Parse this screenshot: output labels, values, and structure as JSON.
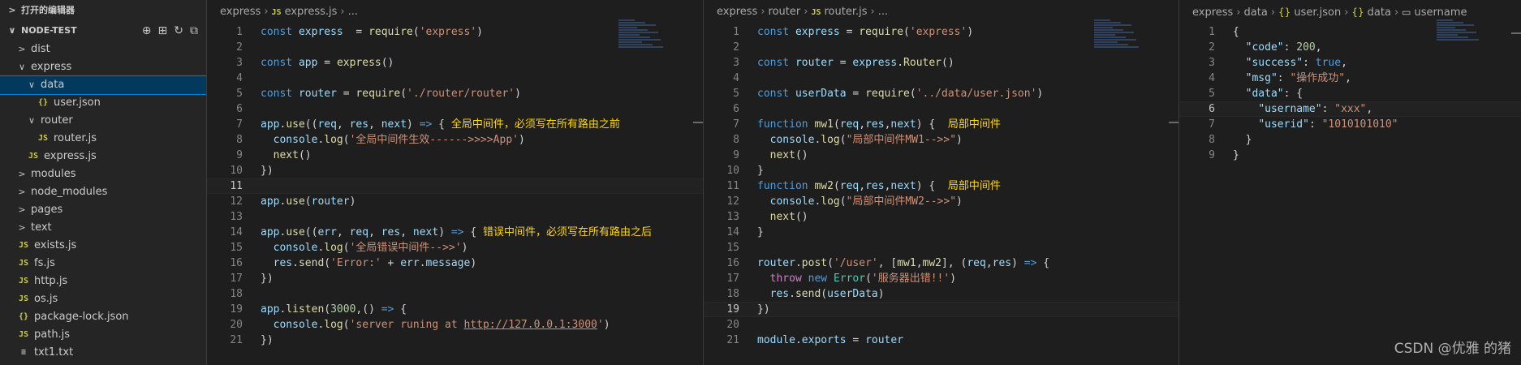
{
  "sidebar": {
    "header": "打开的编辑器",
    "project": "NODE-TEST",
    "tree": [
      {
        "label": "dist",
        "type": "folder",
        "open": false,
        "indent": 0
      },
      {
        "label": "express",
        "type": "folder",
        "open": true,
        "indent": 0
      },
      {
        "label": "data",
        "type": "folder",
        "open": true,
        "indent": 1,
        "selected": true
      },
      {
        "label": "user.json",
        "type": "json",
        "indent": 2
      },
      {
        "label": "router",
        "type": "folder",
        "open": true,
        "indent": 1
      },
      {
        "label": "router.js",
        "type": "js",
        "indent": 2
      },
      {
        "label": "express.js",
        "type": "js",
        "indent": 1
      },
      {
        "label": "modules",
        "type": "folder",
        "open": false,
        "indent": 0
      },
      {
        "label": "node_modules",
        "type": "folder",
        "open": false,
        "indent": 0
      },
      {
        "label": "pages",
        "type": "folder",
        "open": false,
        "indent": 0
      },
      {
        "label": "text",
        "type": "folder",
        "open": false,
        "indent": 0
      },
      {
        "label": "exists.js",
        "type": "js",
        "indent": 0
      },
      {
        "label": "fs.js",
        "type": "js",
        "indent": 0
      },
      {
        "label": "http.js",
        "type": "js",
        "indent": 0
      },
      {
        "label": "os.js",
        "type": "js",
        "indent": 0
      },
      {
        "label": "package-lock.json",
        "type": "json",
        "indent": 0
      },
      {
        "label": "path.js",
        "type": "js",
        "indent": 0
      },
      {
        "label": "txt1.txt",
        "type": "txt",
        "indent": 0
      }
    ]
  },
  "icons": {
    "js": "JS",
    "json": "{}",
    "txt": "≡",
    "folder_open": "∨",
    "folder_closed": ">"
  },
  "editors": [
    {
      "breadcrumb": [
        "express",
        "express.js",
        "..."
      ],
      "breadcrumb_types": [
        "plain",
        "js",
        "plain"
      ],
      "current_line": 11,
      "lines": [
        [
          [
            "kw",
            "const "
          ],
          [
            "var",
            "express"
          ],
          [
            "",
            "  = "
          ],
          [
            "fn",
            "require"
          ],
          [
            "",
            ""
          ],
          [
            "",
            "("
          ],
          [
            "str",
            "'express'"
          ],
          [
            "",
            ")"
          ]
        ],
        [],
        [
          [
            "kw",
            "const "
          ],
          [
            "var",
            "app"
          ],
          [
            "",
            " = "
          ],
          [
            "fn",
            "express"
          ],
          [
            "",
            "()"
          ]
        ],
        [],
        [
          [
            "kw",
            "const "
          ],
          [
            "var",
            "router"
          ],
          [
            "",
            " = "
          ],
          [
            "fn",
            "require"
          ],
          [
            "",
            "("
          ],
          [
            "str",
            "'./router/router'"
          ],
          [
            "",
            ")"
          ]
        ],
        [],
        [
          [
            "var",
            "app"
          ],
          [
            "",
            "."
          ],
          [
            "fn",
            "use"
          ],
          [
            "",
            "(("
          ],
          [
            "var",
            "req"
          ],
          [
            "",
            ", "
          ],
          [
            "var",
            "res"
          ],
          [
            "",
            ", "
          ],
          [
            "var",
            "next"
          ],
          [
            "",
            ") "
          ],
          [
            "kw",
            "=>"
          ],
          [
            "",
            " { "
          ],
          [
            "cmt",
            "全局中间件，必须写在所有路由之前"
          ]
        ],
        [
          [
            "",
            "  "
          ],
          [
            "var",
            "console"
          ],
          [
            "",
            "."
          ],
          [
            "fn",
            "log"
          ],
          [
            "",
            "("
          ],
          [
            "str",
            "'全局中间件生效------>>>>App'"
          ],
          [
            "",
            ")"
          ]
        ],
        [
          [
            "",
            "  "
          ],
          [
            "fn",
            "next"
          ],
          [
            "",
            "()"
          ]
        ],
        [
          [
            "",
            "})"
          ]
        ],
        [],
        [
          [
            "var",
            "app"
          ],
          [
            "",
            "."
          ],
          [
            "fn",
            "use"
          ],
          [
            "",
            "("
          ],
          [
            "var",
            "router"
          ],
          [
            "",
            ")"
          ]
        ],
        [],
        [
          [
            "var",
            "app"
          ],
          [
            "",
            "."
          ],
          [
            "fn",
            "use"
          ],
          [
            "",
            "(("
          ],
          [
            "var",
            "err"
          ],
          [
            "",
            ", "
          ],
          [
            "var",
            "req"
          ],
          [
            "",
            ", "
          ],
          [
            "var",
            "res"
          ],
          [
            "",
            ", "
          ],
          [
            "var",
            "next"
          ],
          [
            "",
            ") "
          ],
          [
            "kw",
            "=>"
          ],
          [
            "",
            " { "
          ],
          [
            "cmt",
            "错误中间件，必须写在所有路由之后"
          ]
        ],
        [
          [
            "",
            "  "
          ],
          [
            "var",
            "console"
          ],
          [
            "",
            "."
          ],
          [
            "fn",
            "log"
          ],
          [
            "",
            "("
          ],
          [
            "str",
            "'全局错误中间件-->>'"
          ],
          [
            "",
            ")"
          ]
        ],
        [
          [
            "",
            "  "
          ],
          [
            "var",
            "res"
          ],
          [
            "",
            "."
          ],
          [
            "fn",
            "send"
          ],
          [
            "",
            "("
          ],
          [
            "str",
            "'Error:'"
          ],
          [
            "",
            " + "
          ],
          [
            "var",
            "err"
          ],
          [
            "",
            "."
          ],
          [
            "var",
            "message"
          ],
          [
            "",
            ")"
          ]
        ],
        [
          [
            "",
            "})"
          ]
        ],
        [],
        [
          [
            "var",
            "app"
          ],
          [
            "",
            "."
          ],
          [
            "fn",
            "listen"
          ],
          [
            "",
            "("
          ],
          [
            "num-lit",
            "3000"
          ],
          [
            "",
            ",() "
          ],
          [
            "kw",
            "=>"
          ],
          [
            "",
            " {"
          ]
        ],
        [
          [
            "",
            "  "
          ],
          [
            "var",
            "console"
          ],
          [
            "",
            "."
          ],
          [
            "fn",
            "log"
          ],
          [
            "",
            "("
          ],
          [
            "str",
            "'server runing at "
          ],
          [
            "str under",
            "http://127.0.0.1:3000"
          ],
          [
            "str",
            "'"
          ],
          [
            "",
            ")"
          ]
        ],
        [
          [
            "",
            "})"
          ]
        ]
      ]
    },
    {
      "breadcrumb": [
        "express",
        "router",
        "router.js",
        "..."
      ],
      "breadcrumb_types": [
        "plain",
        "plain",
        "js",
        "plain"
      ],
      "current_line": 19,
      "lines": [
        [
          [
            "kw",
            "const "
          ],
          [
            "var",
            "express"
          ],
          [
            "",
            " = "
          ],
          [
            "fn",
            "require"
          ],
          [
            "",
            "("
          ],
          [
            "str",
            "'express'"
          ],
          [
            "",
            ")"
          ]
        ],
        [],
        [
          [
            "kw",
            "const "
          ],
          [
            "var",
            "router"
          ],
          [
            "",
            " = "
          ],
          [
            "var",
            "express"
          ],
          [
            "",
            "."
          ],
          [
            "fn",
            "Router"
          ],
          [
            "",
            "()"
          ]
        ],
        [],
        [
          [
            "kw",
            "const "
          ],
          [
            "var",
            "userData"
          ],
          [
            "",
            " = "
          ],
          [
            "fn",
            "require"
          ],
          [
            "",
            "("
          ],
          [
            "str",
            "'../data/user.json'"
          ],
          [
            "",
            ")"
          ]
        ],
        [],
        [
          [
            "kw",
            "function "
          ],
          [
            "fn",
            "mw1"
          ],
          [
            "",
            "("
          ],
          [
            "var",
            "req"
          ],
          [
            "",
            ","
          ],
          [
            "var",
            "res"
          ],
          [
            "",
            ","
          ],
          [
            "var",
            "next"
          ],
          [
            "",
            ") {  "
          ],
          [
            "cmt",
            "局部中间件"
          ]
        ],
        [
          [
            "",
            "  "
          ],
          [
            "var",
            "console"
          ],
          [
            "",
            "."
          ],
          [
            "fn",
            "log"
          ],
          [
            "",
            "("
          ],
          [
            "str",
            "\"局部中间件MW1-->>\""
          ],
          [
            "",
            ")"
          ]
        ],
        [
          [
            "",
            "  "
          ],
          [
            "fn",
            "next"
          ],
          [
            "",
            "()"
          ]
        ],
        [
          [
            "",
            "}"
          ]
        ],
        [
          [
            "kw",
            "function "
          ],
          [
            "fn",
            "mw2"
          ],
          [
            "",
            "("
          ],
          [
            "var",
            "req"
          ],
          [
            "",
            ","
          ],
          [
            "var",
            "res"
          ],
          [
            "",
            ","
          ],
          [
            "var",
            "next"
          ],
          [
            "",
            ") {  "
          ],
          [
            "cmt",
            "局部中间件"
          ]
        ],
        [
          [
            "",
            "  "
          ],
          [
            "var",
            "console"
          ],
          [
            "",
            "."
          ],
          [
            "fn",
            "log"
          ],
          [
            "",
            "("
          ],
          [
            "str",
            "\"局部中间件MW2-->>\""
          ],
          [
            "",
            ")"
          ]
        ],
        [
          [
            "",
            "  "
          ],
          [
            "fn",
            "next"
          ],
          [
            "",
            "()"
          ]
        ],
        [
          [
            "",
            "}"
          ]
        ],
        [],
        [
          [
            "var",
            "router"
          ],
          [
            "",
            "."
          ],
          [
            "fn",
            "post"
          ],
          [
            "",
            "("
          ],
          [
            "str",
            "'/user'"
          ],
          [
            "",
            ", ["
          ],
          [
            "fn",
            "mw1"
          ],
          [
            "",
            ","
          ],
          [
            "fn",
            "mw2"
          ],
          [
            "",
            "], ("
          ],
          [
            "var",
            "req"
          ],
          [
            "",
            ","
          ],
          [
            "var",
            "res"
          ],
          [
            "",
            ") "
          ],
          [
            "kw",
            "=>"
          ],
          [
            "",
            " {"
          ]
        ],
        [
          [
            "",
            "  "
          ],
          [
            "ctl",
            "throw "
          ],
          [
            "kw",
            "new "
          ],
          [
            "cls",
            "Error"
          ],
          [
            "",
            "("
          ],
          [
            "str",
            "'服务器出错!!'"
          ],
          [
            "",
            ")"
          ]
        ],
        [
          [
            "",
            "  "
          ],
          [
            "var",
            "res"
          ],
          [
            "",
            "."
          ],
          [
            "fn",
            "send"
          ],
          [
            "",
            "("
          ],
          [
            "var",
            "userData"
          ],
          [
            "",
            ")"
          ]
        ],
        [
          [
            "",
            "})"
          ]
        ],
        [],
        [
          [
            "var",
            "module"
          ],
          [
            "",
            "."
          ],
          [
            "var",
            "exports"
          ],
          [
            "",
            " = "
          ],
          [
            "var",
            "router"
          ]
        ]
      ]
    },
    {
      "breadcrumb": [
        "express",
        "data",
        "user.json",
        "data",
        "username"
      ],
      "breadcrumb_types": [
        "plain",
        "plain",
        "json",
        "json",
        "abc"
      ],
      "current_line": 6,
      "lines": [
        [
          [
            "",
            "{"
          ]
        ],
        [
          [
            "",
            "  "
          ],
          [
            "var",
            "\"code\""
          ],
          [
            "",
            ": "
          ],
          [
            "num-lit",
            "200"
          ],
          [
            "",
            ","
          ]
        ],
        [
          [
            "",
            "  "
          ],
          [
            "var",
            "\"success\""
          ],
          [
            "",
            ": "
          ],
          [
            "kw",
            "true"
          ],
          [
            "",
            ","
          ]
        ],
        [
          [
            "",
            "  "
          ],
          [
            "var",
            "\"msg\""
          ],
          [
            "",
            ": "
          ],
          [
            "str",
            "\"操作成功\""
          ],
          [
            "",
            ","
          ]
        ],
        [
          [
            "",
            "  "
          ],
          [
            "var",
            "\"data\""
          ],
          [
            "",
            ": {"
          ]
        ],
        [
          [
            "",
            "    "
          ],
          [
            "var",
            "\"username\""
          ],
          [
            "",
            ": "
          ],
          [
            "str",
            "\"xxx\""
          ],
          [
            "",
            ","
          ]
        ],
        [
          [
            "",
            "    "
          ],
          [
            "var",
            "\"userid\""
          ],
          [
            "",
            ": "
          ],
          [
            "str",
            "\"1010101010\""
          ]
        ],
        [
          [
            "",
            "  }"
          ]
        ],
        [
          [
            "",
            "}"
          ]
        ]
      ]
    }
  ],
  "watermark": "CSDN @优雅 的猪"
}
